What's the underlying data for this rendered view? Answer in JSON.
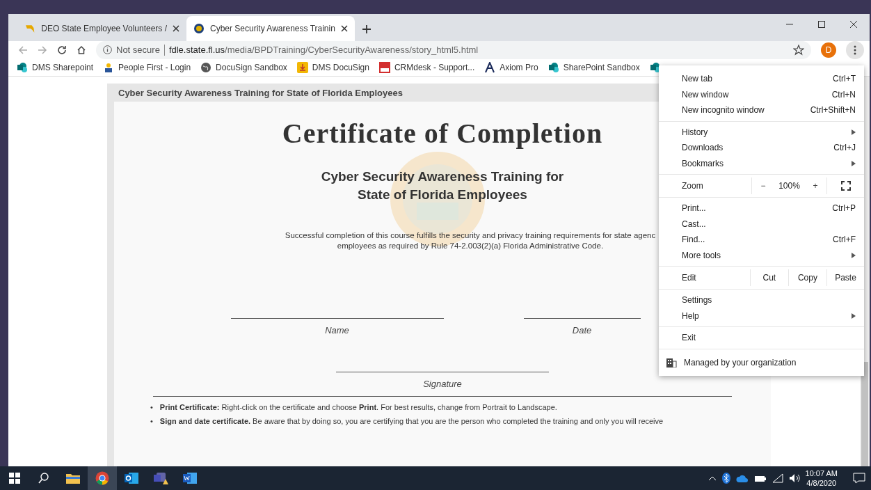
{
  "tabs": [
    {
      "title": "DEO State Employee Volunteers /",
      "selected": false
    },
    {
      "title": "Cyber Security Awareness Trainin",
      "selected": true
    }
  ],
  "address": {
    "security": "Not secure",
    "host": "fdle.state.fl.us",
    "path": "/media/BPDTraining/CyberSecurityAwareness/story_html5.html"
  },
  "profile": "D",
  "bookmarks": [
    {
      "label": "DMS Sharepoint",
      "kind": "sharepoint"
    },
    {
      "label": "People First - Login",
      "kind": "people"
    },
    {
      "label": "DocuSign Sandbox",
      "kind": "globe"
    },
    {
      "label": "DMS DocuSign",
      "kind": "docusign"
    },
    {
      "label": "CRMdesk - Support...",
      "kind": "crm"
    },
    {
      "label": "Axiom Pro",
      "kind": "axiom"
    },
    {
      "label": "SharePoint Sandbox",
      "kind": "sharepoint"
    },
    {
      "kind": "sharepoint"
    }
  ],
  "course_header": "Cyber Security Awareness Training for State of Florida Employees",
  "certificate": {
    "title": "Certificate of Completion",
    "course_lines": [
      "Cyber Security Awareness Training for",
      "State of Florida Employees"
    ],
    "statement_lines": [
      "Successful completion of this course fulfills the security and privacy training requirements for state agenc",
      "employees as required by Rule 74-2.003(2)(a) Florida Administrative Code."
    ],
    "sign_fields": [
      "Name",
      "Date",
      "Signature"
    ]
  },
  "instructions": [
    {
      "marker": "•",
      "text": "**Print Certificate:** Right-click on the certificate and choose **Print**. For best results, change from Portrait to Landscape."
    },
    {
      "marker": "•",
      "text": "**Sign and date certificate.** Be aware that by doing so, you are certifying that you are the person who completed the training and only you will receive"
    }
  ],
  "menu": {
    "groups": [
      [
        {
          "kind": "item",
          "label": "New tab",
          "shortcut": "Ctrl+T"
        },
        {
          "kind": "item",
          "label": "New window",
          "shortcut": "Ctrl+N"
        },
        {
          "kind": "item",
          "label": "New incognito window",
          "shortcut": "Ctrl+Shift+N"
        }
      ],
      [
        {
          "kind": "submenu",
          "label": "History"
        },
        {
          "kind": "item",
          "label": "Downloads",
          "shortcut": "Ctrl+J"
        },
        {
          "kind": "submenu",
          "label": "Bookmarks"
        }
      ],
      [
        {
          "kind": "zoom",
          "label": "Zoom",
          "minus": "−",
          "value": "100%",
          "plus": "+"
        }
      ],
      [
        {
          "kind": "item",
          "label": "Print...",
          "shortcut": "Ctrl+P"
        },
        {
          "kind": "item",
          "label": "Cast..."
        },
        {
          "kind": "item",
          "label": "Find...",
          "shortcut": "Ctrl+F"
        },
        {
          "kind": "submenu",
          "label": "More tools"
        }
      ],
      [
        {
          "kind": "edit",
          "label": "Edit",
          "actions": [
            "Cut",
            "Copy",
            "Paste"
          ]
        }
      ],
      [
        {
          "kind": "item",
          "label": "Settings"
        },
        {
          "kind": "submenu",
          "label": "Help"
        }
      ],
      [
        {
          "kind": "item",
          "label": "Exit"
        }
      ]
    ],
    "managed": "Managed by your organization"
  },
  "clock": {
    "time": "10:07 AM",
    "date": "4/8/2020"
  }
}
